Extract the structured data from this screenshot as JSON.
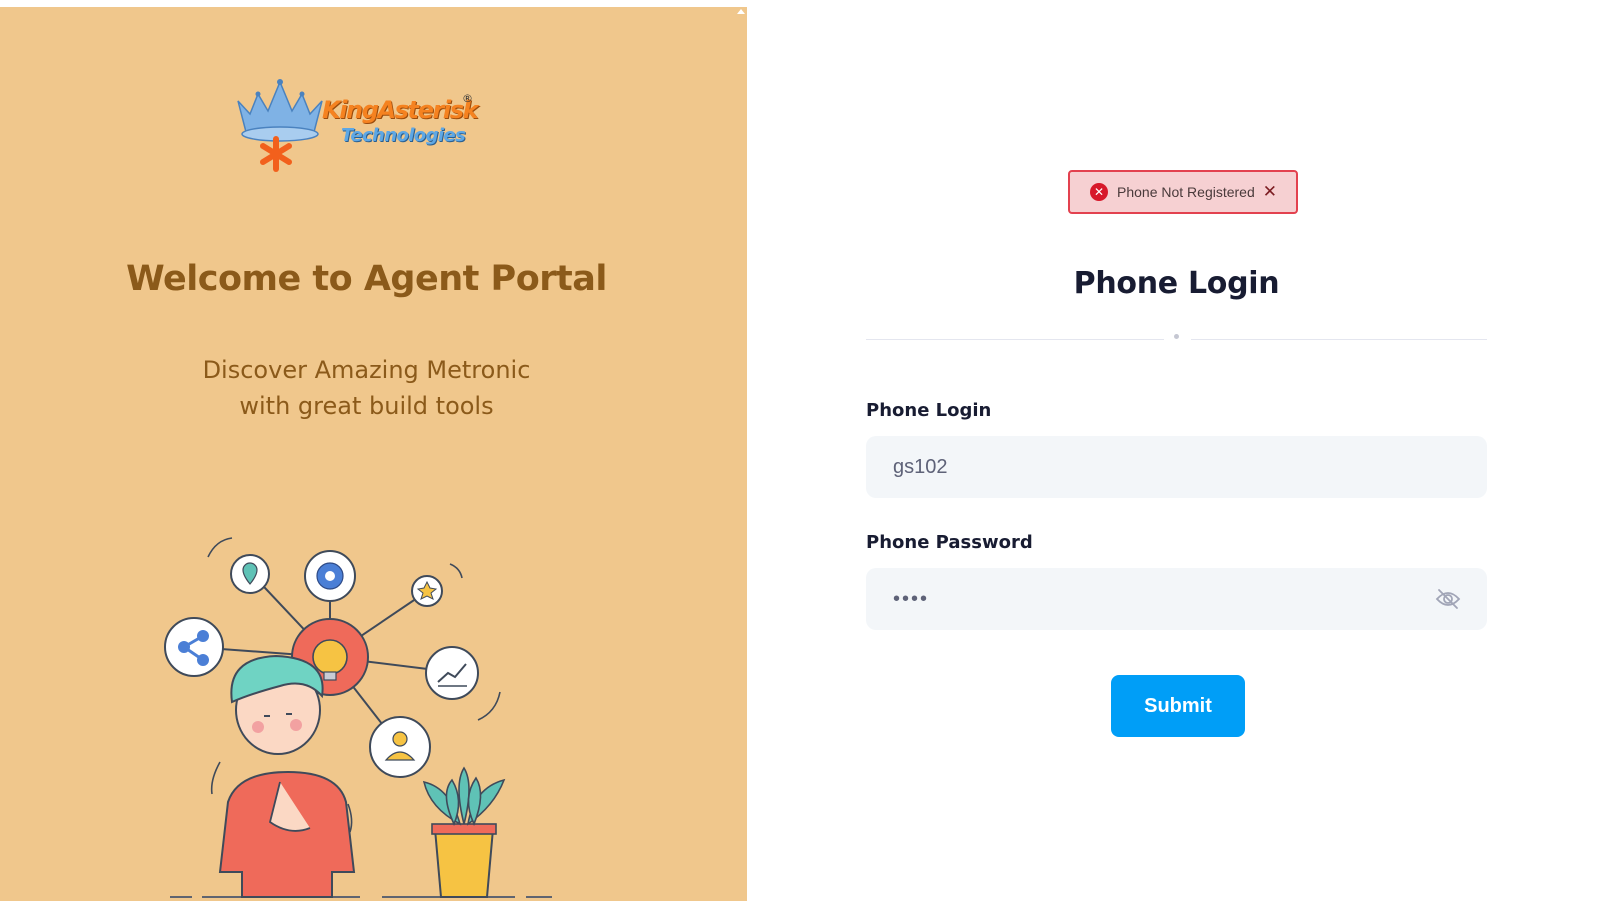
{
  "brand": {
    "name_line1": "KingAsterisk",
    "name_line2": "Technologies",
    "registered_mark": "®"
  },
  "aside": {
    "welcome_title": "Welcome to Agent Portal",
    "tagline_line1": "Discover Amazing Metronic",
    "tagline_line2": "with great build tools",
    "background_color": "#f0c78c",
    "text_color": "#8b5a1a"
  },
  "alert": {
    "message": "Phone Not Registered",
    "icon": "error-circle-icon",
    "close_icon": "close-icon",
    "color": "#e3414f"
  },
  "form": {
    "title": "Phone Login",
    "login_label": "Phone Login",
    "login_value": "gs102",
    "password_label": "Phone Password",
    "password_value": "••••",
    "password_toggle_icon": "eye-slash-icon",
    "submit_label": "Submit",
    "accent_color": "#009ef7"
  }
}
